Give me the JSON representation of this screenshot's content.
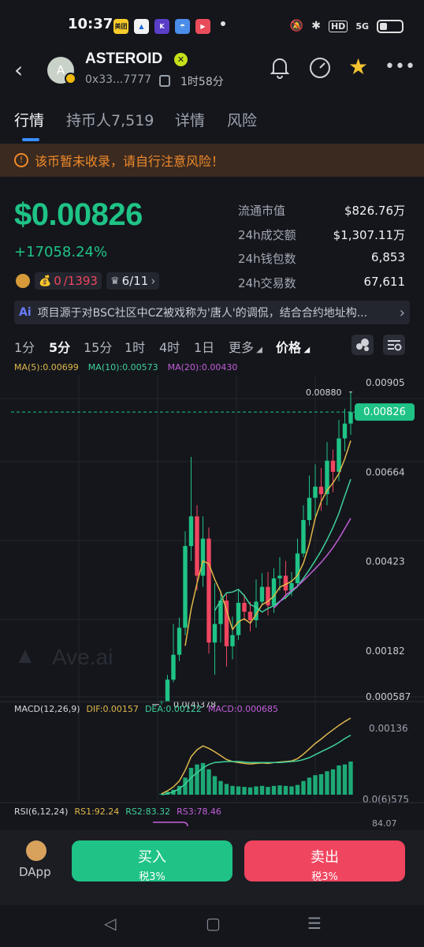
{
  "status_bar": {
    "time": "10:37",
    "app_icons": [
      "美团",
      "",
      "K",
      "",
      ""
    ],
    "network": "HD",
    "signal": "5G"
  },
  "header": {
    "token_name": "ASTEROID",
    "avatar_letter": "A",
    "address": "0x33...7777",
    "age": "1时58分"
  },
  "tabs": [
    {
      "label": "行情",
      "active": true
    },
    {
      "label": "持币人7,519",
      "active": false
    },
    {
      "label": "详情",
      "active": false
    },
    {
      "label": "风险",
      "active": false
    }
  ],
  "warning": "该币暂未收录，请自行注意风险！",
  "price": {
    "value": "$0.00826",
    "change": "+17058.24%",
    "badge_ratio_left": "0",
    "badge_ratio_right": "/1393",
    "badge_crown": "6/11"
  },
  "stats": [
    {
      "label": "流通市值",
      "value": "$826.76万"
    },
    {
      "label": "24h成交额",
      "value": "$1,307.11万"
    },
    {
      "label": "24h钱包数",
      "value": "6,853"
    },
    {
      "label": "24h交易数",
      "value": "67,611"
    }
  ],
  "ai_banner": {
    "icon": "Ai",
    "text": "项目源于对BSC社区中CZ被戏称为'唐人'的调侃，结合合约地址构..."
  },
  "timeframes": [
    {
      "label": "1分",
      "active": false
    },
    {
      "label": "5分",
      "active": true
    },
    {
      "label": "15分",
      "active": false
    },
    {
      "label": "1时",
      "active": false
    },
    {
      "label": "4时",
      "active": false
    },
    {
      "label": "1日",
      "active": false
    },
    {
      "label": "更多",
      "active": false
    },
    {
      "label": "价格",
      "active": true
    }
  ],
  "chart": {
    "ma_legend": [
      {
        "label": "MA(5):0.00699",
        "color": "#e0b84a"
      },
      {
        "label": "MA(10):0.00573",
        "color": "#3fd19a"
      },
      {
        "label": "MA(20):0.00430",
        "color": "#c45ed8"
      }
    ],
    "price_axis": [
      "0.00905",
      "0.00664",
      "0.00423",
      "0.00182",
      "0.000587"
    ],
    "current_price_tag": "0.00826",
    "high_label": "0.00880",
    "low_label": "0.0(4)378",
    "watermark": "Ave.ai",
    "macd_legend": [
      {
        "label": "MACD(12,26,9)",
        "color": "#d6d8de"
      },
      {
        "label": "DIF:0.00157",
        "color": "#e0b84a"
      },
      {
        "label": "DEA:0.00122",
        "color": "#3fd19a"
      },
      {
        "label": "MACD:0.000685",
        "color": "#c45ed8"
      }
    ],
    "macd_axis": [
      "0.00136",
      "0.0(6)575"
    ],
    "rsi_legend": [
      {
        "label": "RSI(6,12,24)",
        "color": "#d6d8de"
      },
      {
        "label": "RS1:92.24",
        "color": "#e0b84a"
      },
      {
        "label": "RS2:83.32",
        "color": "#3fd19a"
      },
      {
        "label": "RS3:78.46",
        "color": "#c45ed8"
      }
    ],
    "colors": {
      "up": "#1fc386",
      "down": "#f0455f",
      "grid": "#23262e"
    }
  },
  "chart_data": {
    "type": "candlestick",
    "ylim": [
      0.000587,
      0.00905
    ],
    "current_price": 0.00826,
    "candles": [
      {
        "o": 0.00046,
        "c": 0.00047,
        "h": 0.00049,
        "l": 0.00038
      },
      {
        "o": 0.00047,
        "c": 0.00105,
        "h": 0.00118,
        "l": 0.00045
      },
      {
        "o": 0.00105,
        "c": 0.00172,
        "h": 0.00255,
        "l": 0.00098
      },
      {
        "o": 0.00172,
        "c": 0.00245,
        "h": 0.00272,
        "l": 0.00155
      },
      {
        "o": 0.00245,
        "c": 0.00465,
        "h": 0.00505,
        "l": 0.00225
      },
      {
        "o": 0.00465,
        "c": 0.00545,
        "h": 0.00705,
        "l": 0.00425
      },
      {
        "o": 0.00545,
        "c": 0.00385,
        "h": 0.00575,
        "l": 0.00345
      },
      {
        "o": 0.00385,
        "c": 0.00485,
        "h": 0.00545,
        "l": 0.00355
      },
      {
        "o": 0.00485,
        "c": 0.00205,
        "h": 0.00515,
        "l": 0.00175
      },
      {
        "o": 0.00205,
        "c": 0.00255,
        "h": 0.00365,
        "l": 0.00118
      },
      {
        "o": 0.00255,
        "c": 0.00318,
        "h": 0.00345,
        "l": 0.00205
      },
      {
        "o": 0.00318,
        "c": 0.00195,
        "h": 0.00335,
        "l": 0.0014
      },
      {
        "o": 0.00195,
        "c": 0.00225,
        "h": 0.00275,
        "l": 0.0016
      },
      {
        "o": 0.00225,
        "c": 0.00312,
        "h": 0.00345,
        "l": 0.00212
      },
      {
        "o": 0.00312,
        "c": 0.00288,
        "h": 0.00335,
        "l": 0.00265
      },
      {
        "o": 0.00288,
        "c": 0.00265,
        "h": 0.00315,
        "l": 0.00235
      },
      {
        "o": 0.00265,
        "c": 0.00315,
        "h": 0.00375,
        "l": 0.00245
      },
      {
        "o": 0.00315,
        "c": 0.00355,
        "h": 0.00392,
        "l": 0.00305
      },
      {
        "o": 0.00355,
        "c": 0.00305,
        "h": 0.00395,
        "l": 0.00278
      },
      {
        "o": 0.00305,
        "c": 0.00378,
        "h": 0.00405,
        "l": 0.00285
      },
      {
        "o": 0.00378,
        "c": 0.00385,
        "h": 0.00435,
        "l": 0.00345
      },
      {
        "o": 0.00385,
        "c": 0.00345,
        "h": 0.00425,
        "l": 0.00322
      },
      {
        "o": 0.00345,
        "c": 0.00365,
        "h": 0.00395,
        "l": 0.0033
      },
      {
        "o": 0.00365,
        "c": 0.00445,
        "h": 0.00485,
        "l": 0.00355
      },
      {
        "o": 0.00445,
        "c": 0.00535,
        "h": 0.00575,
        "l": 0.00435
      },
      {
        "o": 0.00535,
        "c": 0.00595,
        "h": 0.00655,
        "l": 0.0052
      },
      {
        "o": 0.00595,
        "c": 0.00625,
        "h": 0.00685,
        "l": 0.00545
      },
      {
        "o": 0.00625,
        "c": 0.00605,
        "h": 0.00675,
        "l": 0.0056
      },
      {
        "o": 0.00605,
        "c": 0.00695,
        "h": 0.00745,
        "l": 0.00575
      },
      {
        "o": 0.00695,
        "c": 0.00665,
        "h": 0.00725,
        "l": 0.0061
      },
      {
        "o": 0.00665,
        "c": 0.00755,
        "h": 0.00805,
        "l": 0.0064
      },
      {
        "o": 0.00755,
        "c": 0.00795,
        "h": 0.00835,
        "l": 0.0072
      },
      {
        "o": 0.00795,
        "c": 0.00826,
        "h": 0.0088,
        "l": 0.00765
      }
    ],
    "ma5": [
      null,
      null,
      null,
      null,
      0.00196,
      0.00295,
      0.00365,
      0.00425,
      0.00417,
      0.00375,
      0.00341,
      0.00292,
      0.0024,
      0.00261,
      0.00269,
      0.00257,
      0.00281,
      0.00307,
      0.00316,
      0.0033,
      0.00354,
      0.00362,
      0.0037,
      0.00386,
      0.00419,
      0.0047,
      0.0054,
      0.00585,
      0.00615,
      0.00635,
      0.0066,
      0.007,
      0.00749
    ],
    "ma10": [
      null,
      null,
      null,
      null,
      null,
      null,
      null,
      null,
      null,
      0.00291,
      0.00318,
      0.00339,
      0.00341,
      0.00348,
      0.00331,
      0.00307,
      0.003,
      0.00287,
      0.00297,
      0.00304,
      0.00316,
      0.00326,
      0.00342,
      0.00356,
      0.00378,
      0.00401,
      0.00426,
      0.00452,
      0.00482,
      0.00515,
      0.00553,
      0.006,
      0.00645
    ],
    "ma20": [
      null,
      null,
      null,
      null,
      null,
      null,
      null,
      null,
      null,
      null,
      null,
      null,
      null,
      null,
      null,
      null,
      null,
      null,
      null,
      0.00298,
      0.00315,
      0.00333,
      0.00345,
      0.00357,
      0.00372,
      0.00388,
      0.00404,
      0.00421,
      0.0044,
      0.00461,
      0.00485,
      0.00512,
      0.0054
    ],
    "macd_hist": [
      2e-05,
      6e-05,
      0.0001,
      0.00018,
      0.00035,
      0.00055,
      0.00062,
      0.00065,
      0.00052,
      0.00038,
      0.00028,
      0.00022,
      0.00018,
      0.00017,
      0.00016,
      0.00015,
      0.00017,
      0.00018,
      0.00016,
      0.00018,
      0.00019,
      0.00018,
      0.00017,
      0.0002,
      0.00028,
      0.00035,
      0.0004,
      0.00042,
      0.00048,
      0.00052,
      0.0006,
      0.00062,
      0.00068
    ],
    "dif": [
      2e-05,
      8e-05,
      0.00016,
      0.00028,
      0.0005,
      0.00078,
      0.00092,
      0.001,
      0.00095,
      0.00088,
      0.0008,
      0.00072,
      0.00068,
      0.00066,
      0.00064,
      0.00063,
      0.00064,
      0.00065,
      0.00064,
      0.00066,
      0.00067,
      0.00068,
      0.00069,
      0.00074,
      0.00083,
      0.00094,
      0.00105,
      0.00114,
      0.00124,
      0.00133,
      0.00142,
      0.0015,
      0.00157
    ],
    "dea": [
      0.0,
      2e-05,
      6e-05,
      0.00012,
      0.00022,
      0.00035,
      0.00045,
      0.00055,
      0.00062,
      0.00066,
      0.00067,
      0.00068,
      0.00068,
      0.00068,
      0.00067,
      0.00066,
      0.00066,
      0.00066,
      0.00066,
      0.00066,
      0.00066,
      0.00067,
      0.00068,
      0.00069,
      0.00072,
      0.00076,
      0.00082,
      0.00088,
      0.00094,
      0.001,
      0.00107,
      0.00115,
      0.00122
    ],
    "macd_ylim": [
      0.0,
      0.00165
    ]
  },
  "bottom": {
    "dapp_label": "DApp",
    "buy_label": "买入",
    "buy_tax": "税3%",
    "sell_label": "卖出",
    "sell_tax": "税3%",
    "buy_color": "#1fc386",
    "sell_color": "#f0455f"
  }
}
